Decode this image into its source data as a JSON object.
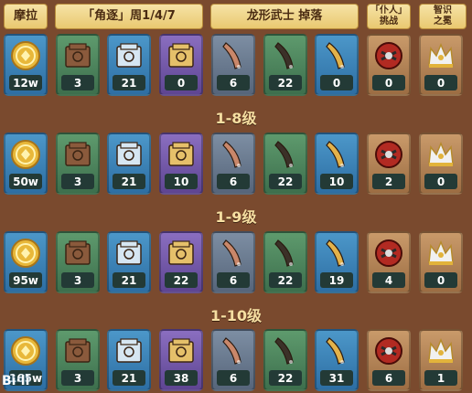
{
  "headers": {
    "mora": "摩拉",
    "book": "「角逐」周1/4/7",
    "drop": "龙形武士 掉落",
    "challenge_top": "「仆人」",
    "challenge_bottom": "挑战",
    "crown_top": "智识",
    "crown_bottom": "之冕"
  },
  "rows": [
    {
      "level": "",
      "values": [
        "12w",
        "3",
        "21",
        "0",
        "6",
        "22",
        "0",
        "0",
        "0"
      ]
    },
    {
      "level": "1-8级",
      "values": [
        "50w",
        "3",
        "21",
        "10",
        "6",
        "22",
        "10",
        "2",
        "0"
      ]
    },
    {
      "level": "1-9级",
      "values": [
        "95w",
        "3",
        "21",
        "22",
        "6",
        "22",
        "19",
        "4",
        "0"
      ]
    },
    {
      "level": "1-10级",
      "values": [
        "165w",
        "3",
        "21",
        "38",
        "6",
        "22",
        "31",
        "6",
        "1"
      ]
    }
  ],
  "colors": {
    "background": "#7a4a2e",
    "header_bg": "#f6e3a6",
    "count_bg": "#233a36",
    "level_text": "#f6dfa2"
  },
  "watermark": "Bi·li"
}
